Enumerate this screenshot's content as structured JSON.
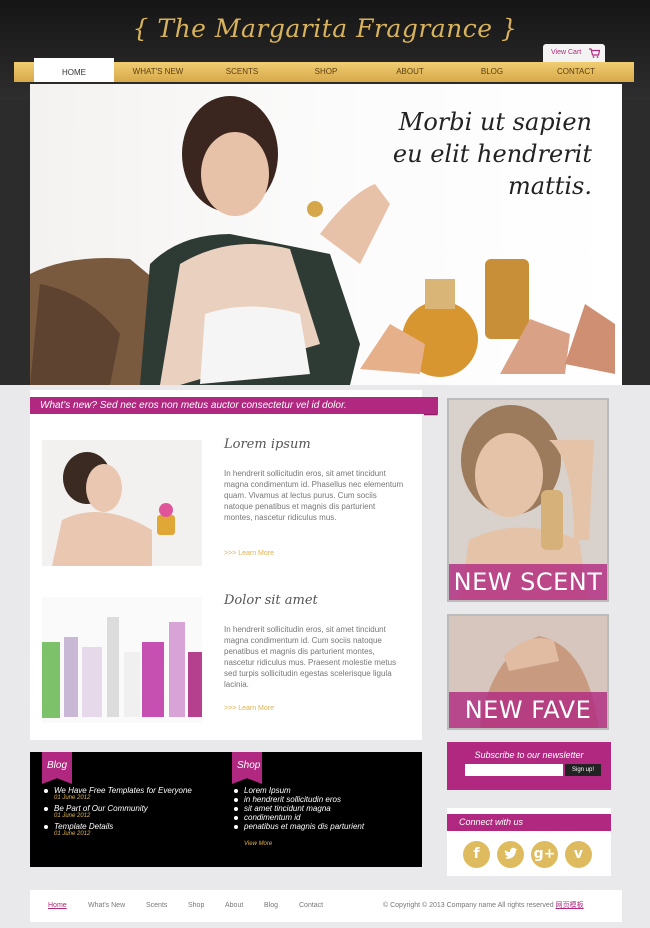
{
  "brand": {
    "logo_text": "{ The Margarita Fragrance }"
  },
  "cart": {
    "label": "View Cart"
  },
  "nav": {
    "items": [
      "HOME",
      "WHAT'S NEW",
      "SCENTS",
      "SHOP",
      "ABOUT",
      "BLOG",
      "CONTACT"
    ],
    "active": "HOME"
  },
  "hero": {
    "lines": [
      "Morbi ut sapien",
      "eu elit hendrerit",
      "mattis."
    ]
  },
  "whats_new": {
    "banner": "What's new? Sed nec eros non metus auctor consectetur vel id dolor."
  },
  "features": [
    {
      "title": "Lorem ipsum",
      "body": "In hendrerit sollicitudin eros, sit amet tincidunt magna condimentum id. Phasellus nec elementum quam. Vivamus at lectus purus. Cum sociis natoque penatibus et magnis dis parturient montes, nascetur ridiculus mus.",
      "link": ">>> Learn More"
    },
    {
      "title": "Dolor sit amet",
      "body": "In hendrerit sollicitudin eros, sit amet tincidunt magna condimentum id. Cum sociis natoque penatibus et magnis dis parturient montes, nascetur ridiculus mus. Praesent molestie metus sed turpis sollicitudin egestas scelerisque ligula lacinia.",
      "link": ">>> Learn More"
    }
  ],
  "blog": {
    "tag": "Blog",
    "posts": [
      {
        "title": "We Have Free Templates for Everyone",
        "date": "01 June 2012"
      },
      {
        "title": "Be Part of Our Community",
        "date": "01 June 2012"
      },
      {
        "title": "Template Details",
        "date": "01 June 2012"
      }
    ]
  },
  "shop": {
    "tag": "Shop",
    "items": [
      "Lorem Ipsum",
      "in hendrerit sollicitudin eros",
      "sit amet tincidunt magna",
      "condimentum id",
      "penatibus et magnis dis parturient"
    ],
    "view_more": "View More"
  },
  "promos": {
    "new_scent": "NEW SCENT",
    "new_fave": "NEW FAVE"
  },
  "newsletter": {
    "title": "Subscribe to our newsletter",
    "button": "Sign up!",
    "placeholder": ""
  },
  "connect": {
    "title": "Connect with us",
    "icons": [
      "facebook-icon",
      "twitter-icon",
      "google-plus-icon",
      "vimeo-icon"
    ]
  },
  "footer": {
    "links": [
      "Home",
      "What's New",
      "Scents",
      "Shop",
      "About",
      "Blog",
      "Contact"
    ],
    "active": "Home",
    "copyright": "© Copyright © 2013 Company name All rights reserved",
    "copyright_link": "网页模板"
  },
  "colors": {
    "accent": "#b0287f",
    "gold": "#e0b24f",
    "dark": "#000000"
  }
}
